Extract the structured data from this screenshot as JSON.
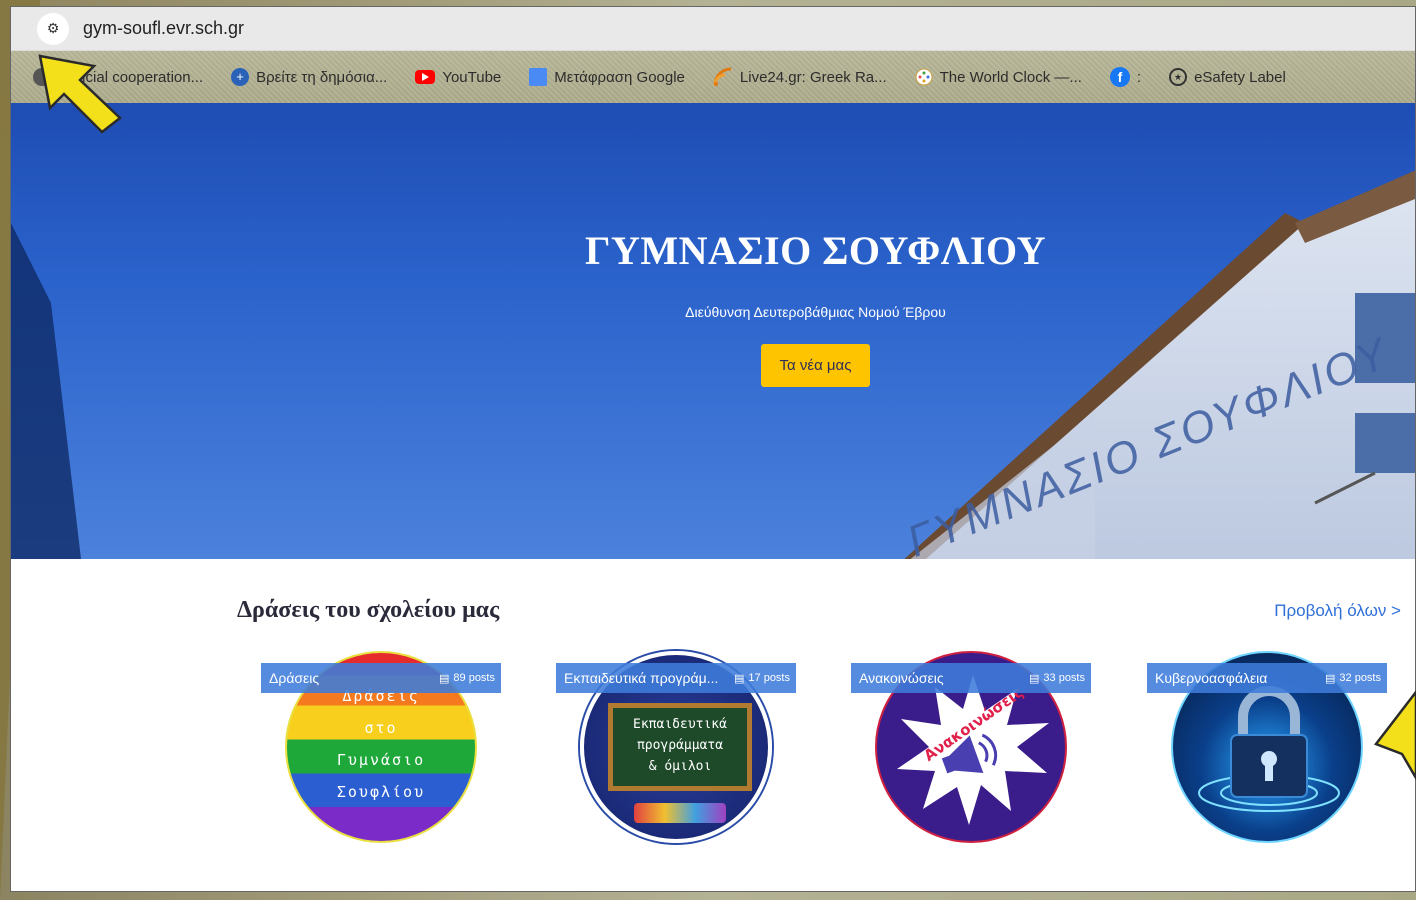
{
  "browser": {
    "url": "gym-soufl.evr.sch.gr",
    "bookmarks": [
      {
        "label": "Judicial cooperation...",
        "icon": "globe-icon",
        "color": "#3b5998"
      },
      {
        "label": "Βρείτε τη δημόσια...",
        "icon": "plus-circle-icon",
        "color": "#2a62b8"
      },
      {
        "label": "YouTube",
        "icon": "youtube-icon",
        "color": "#ff0000"
      },
      {
        "label": "Μετάφραση Google",
        "icon": "google-translate-icon",
        "color": "#4a8af4"
      },
      {
        "label": "Live24.gr: Greek Ra...",
        "icon": "radio-icon",
        "color": "#e07a10"
      },
      {
        "label": "The World Clock —...",
        "icon": "world-clock-icon",
        "color": "#d9a33c"
      },
      {
        "label": ":",
        "icon": "facebook-icon",
        "color": "#1877f2"
      },
      {
        "label": "eSafety Label",
        "icon": "esafety-icon",
        "color": "#333333"
      }
    ]
  },
  "hero": {
    "title": "ΓΥΜΝΑΣΙΟ ΣΟΥΦΛΙΟΥ",
    "subtitle": "Διεύθυνση Δευτεροβάθμιας Νομού Έβρου",
    "button_label": "Τα νέα μας",
    "building_sign": "ΓΥΜΝΑΣΙΟ ΣΟΥΦΛΙΟΥ"
  },
  "section": {
    "title": "Δράσεις του σχολείου μας",
    "view_all": "Προβολή όλων >"
  },
  "categories": [
    {
      "name": "Δράσεις",
      "posts": "89 posts",
      "image_lines": [
        "Δράσεις",
        "στο",
        "Γυμνάσιο",
        "Σουφλίου"
      ]
    },
    {
      "name": "Εκπαιδευτικά προγράμ...",
      "posts": "17 posts",
      "image_lines": [
        "Εκπαιδευτικά",
        "προγράμματα",
        "& όμιλοι"
      ]
    },
    {
      "name": "Ανακοινώσεις",
      "posts": "33 posts",
      "image_lines": [
        "Ανακοινώσεις"
      ]
    },
    {
      "name": "Κυβερνοασφάλεια",
      "posts": "32 posts"
    }
  ],
  "colors": {
    "accent_yellow": "#ffc400",
    "tag_blue": "#3d7cdb",
    "link_blue": "#2e6fd8",
    "hero_blue": "#2b63cc"
  }
}
